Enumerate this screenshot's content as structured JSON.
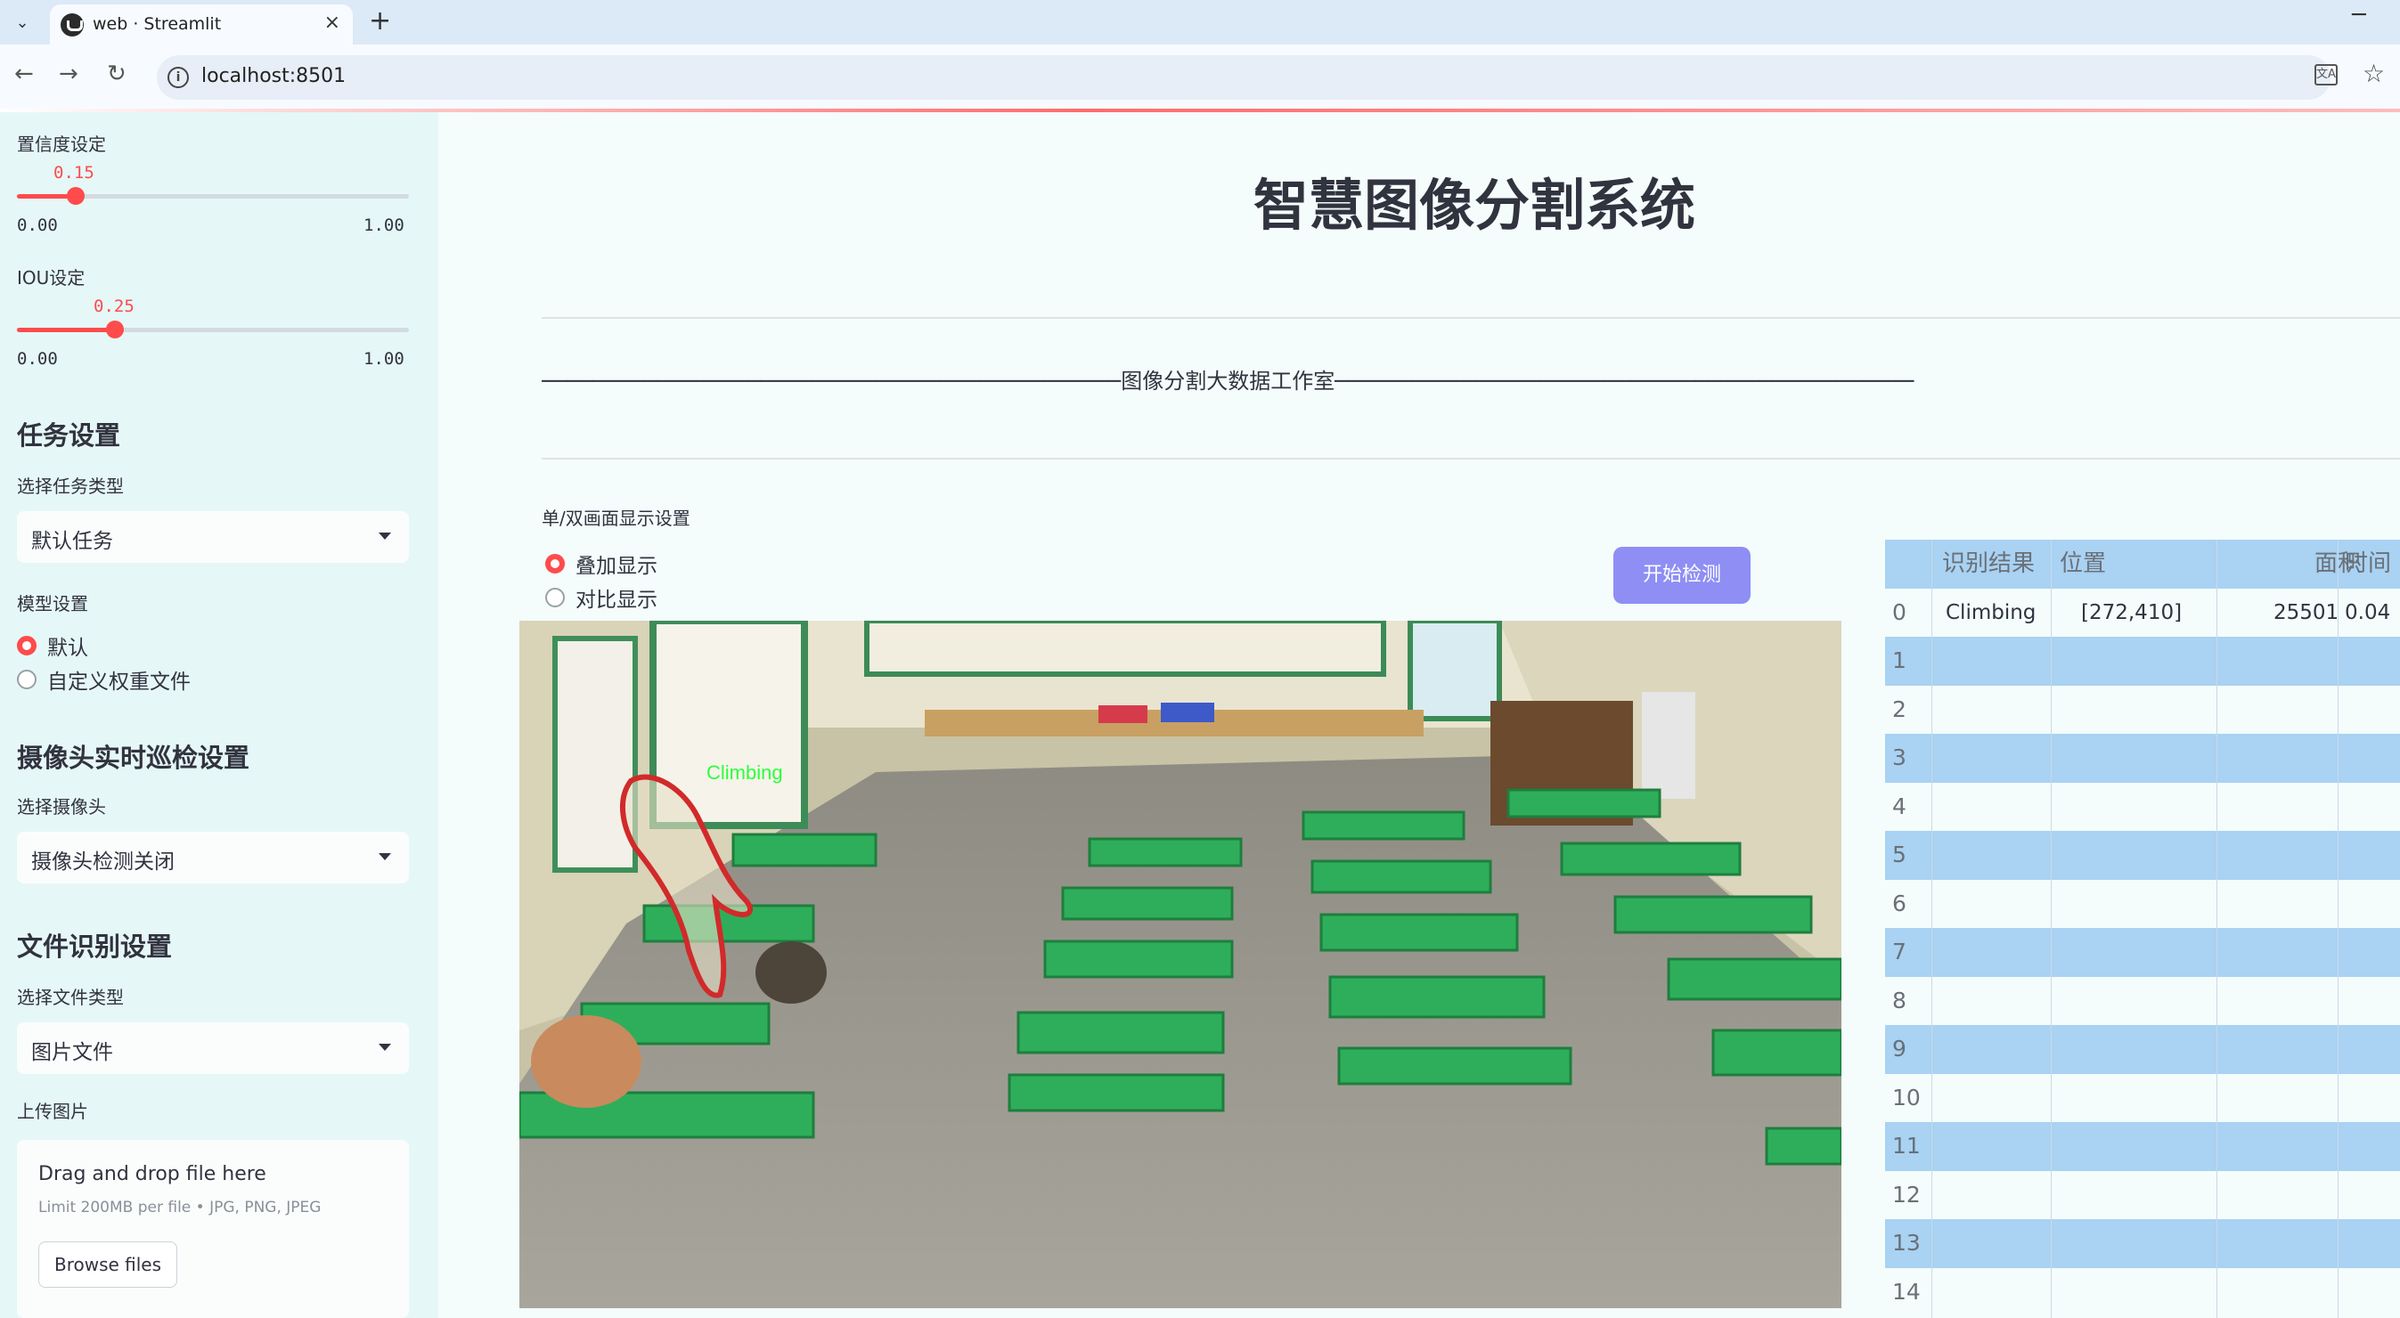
{
  "browser": {
    "tab_title": "web · Streamlit",
    "url": "localhost:8501",
    "new_tab": "+",
    "close": "×",
    "minimize": "─",
    "translate_label": "文A"
  },
  "sidebar": {
    "confidence": {
      "label": "置信度设定",
      "value": "0.15",
      "value_num": 0.15,
      "min": "0.00",
      "max": "1.00"
    },
    "iou": {
      "label": "IOU设定",
      "value": "0.25",
      "value_num": 0.25,
      "min": "0.00",
      "max": "1.00"
    },
    "task_header": "任务设置",
    "task_type_label": "选择任务类型",
    "task_type_value": "默认任务",
    "model_label": "模型设置",
    "model_options": [
      "默认",
      "自定义权重文件"
    ],
    "model_selected": "默认",
    "camera_header": "摄像头实时巡检设置",
    "camera_label": "选择摄像头",
    "camera_value": "摄像头检测关闭",
    "file_header": "文件识别设置",
    "file_type_label": "选择文件类型",
    "file_type_value": "图片文件",
    "upload_label": "上传图片",
    "upload_title": "Drag and drop file here",
    "upload_limit": "Limit 200MB per file • JPG, PNG, JPEG",
    "browse_label": "Browse files"
  },
  "main": {
    "title": "智慧图像分割系统",
    "banner_text": "图像分割大数据工作室",
    "display_label": "单/双画面显示设置",
    "display_options": [
      "叠加显示",
      "对比显示"
    ],
    "display_selected": "叠加显示",
    "detect_button": "开始检测",
    "detection_label": "Climbing"
  },
  "table": {
    "headers": [
      "识别结果",
      "位置",
      "面积",
      "时间"
    ],
    "rows": [
      {
        "index": "0",
        "result": "Climbing",
        "position": "[272,410]",
        "area": "25501",
        "time": "0.04"
      },
      {
        "index": "1",
        "result": "",
        "position": "",
        "area": "",
        "time": ""
      },
      {
        "index": "2",
        "result": "",
        "position": "",
        "area": "",
        "time": ""
      },
      {
        "index": "3",
        "result": "",
        "position": "",
        "area": "",
        "time": ""
      },
      {
        "index": "4",
        "result": "",
        "position": "",
        "area": "",
        "time": ""
      },
      {
        "index": "5",
        "result": "",
        "position": "",
        "area": "",
        "time": ""
      },
      {
        "index": "6",
        "result": "",
        "position": "",
        "area": "",
        "time": ""
      },
      {
        "index": "7",
        "result": "",
        "position": "",
        "area": "",
        "time": ""
      },
      {
        "index": "8",
        "result": "",
        "position": "",
        "area": "",
        "time": ""
      },
      {
        "index": "9",
        "result": "",
        "position": "",
        "area": "",
        "time": ""
      },
      {
        "index": "10",
        "result": "",
        "position": "",
        "area": "",
        "time": ""
      },
      {
        "index": "11",
        "result": "",
        "position": "",
        "area": "",
        "time": ""
      },
      {
        "index": "12",
        "result": "",
        "position": "",
        "area": "",
        "time": ""
      },
      {
        "index": "13",
        "result": "",
        "position": "",
        "area": "",
        "time": ""
      },
      {
        "index": "14",
        "result": "",
        "position": "",
        "area": "",
        "time": ""
      }
    ]
  },
  "colors": {
    "accent": "#ff4b4b",
    "button": "#8e8ef5",
    "table_stripe": "#a9d2f3",
    "sidebar_bg": "#e6f7f7"
  }
}
